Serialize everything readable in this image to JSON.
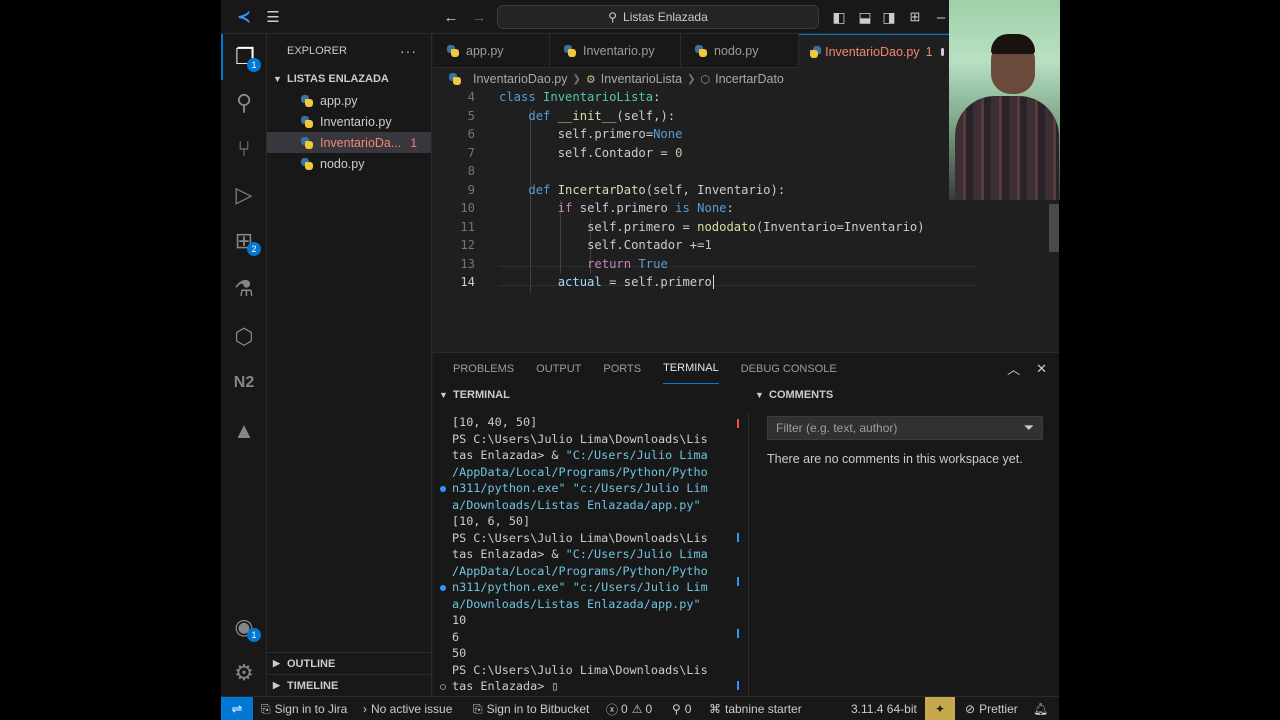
{
  "title_bar": {
    "search_text": "Listas Enlazada"
  },
  "explorer": {
    "title": "EXPLORER",
    "more": "···",
    "folder": "LISTAS ENLAZADA",
    "files": [
      {
        "name": "app.py"
      },
      {
        "name": "Inventario.py"
      },
      {
        "name": "InventarioDa...",
        "problems": "1"
      },
      {
        "name": "nodo.py"
      }
    ],
    "outline": "OUTLINE",
    "timeline": "TIMELINE"
  },
  "activity_badges": {
    "explorer": "1",
    "extensions": "2",
    "accounts": "1"
  },
  "tabs": [
    {
      "label": "app.py"
    },
    {
      "label": "Inventario.py"
    },
    {
      "label": "nodo.py"
    },
    {
      "label": "InventarioDao.py",
      "count": "1"
    }
  ],
  "breadcrumb": {
    "file": "InventarioDao.py",
    "class": "InventarioLista",
    "method": "IncertarDato"
  },
  "code_lines": [
    {
      "n": "4"
    },
    {
      "n": "5"
    },
    {
      "n": "6"
    },
    {
      "n": "7"
    },
    {
      "n": "8"
    },
    {
      "n": "9"
    },
    {
      "n": "10"
    },
    {
      "n": "11"
    },
    {
      "n": "12"
    },
    {
      "n": "13"
    },
    {
      "n": "14"
    }
  ],
  "code": {
    "l4_kw": "class",
    "l4_name": "InventarioLista",
    "l4_end": ":",
    "l5_kw": "def",
    "l5_fn": "__init__",
    "l5_rest": "(self,):",
    "l6_a": "self.primero=",
    "l6_b": "None",
    "l7_a": "self.Contador = ",
    "l7_b": "0",
    "l9_kw": "def",
    "l9_fn": "IncertarDato",
    "l9_rest": "(self, Inventario):",
    "l10_kw": "if",
    "l10_a": " self.primero ",
    "l10_is": "is",
    "l10_none": " None",
    "l10_end": ":",
    "l11_a": "self.primero = ",
    "l11_fn": "nododato",
    "l11_rest": "(Inventario=Inventario)",
    "l12_a": "self.Contador +=",
    "l12_b": "1",
    "l13_kw": "return",
    "l13_b": " True",
    "l14_a": "actual",
    "l14_b": " = self.primero"
  },
  "panel_tabs": [
    "PROBLEMS",
    "OUTPUT",
    "PORTS",
    "TERMINAL",
    "DEBUG CONSOLE"
  ],
  "terminal": {
    "header": "TERMINAL",
    "lines": [
      {
        "t": "[10, 40, 50]"
      },
      {
        "t": "PS C:\\Users\\Julio Lima\\Downloads\\Lis"
      },
      {
        "t": "tas Enlazada> & ",
        "s": "\"C:/Users/Julio Lima"
      },
      {
        "s": "/AppData/Local/Programs/Python/Pytho"
      },
      {
        "s": "n311/python.exe\"",
        "t2": " \"c:/Users/Julio Lim"
      },
      {
        "t2": "a/Downloads/Listas Enlazada/app.py\""
      },
      {
        "t": "[10, 6, 50]"
      },
      {
        "t": "PS C:\\Users\\Julio Lima\\Downloads\\Lis"
      },
      {
        "t": "tas Enlazada> & ",
        "s": "\"C:/Users/Julio Lima"
      },
      {
        "s": "/AppData/Local/Programs/Python/Pytho"
      },
      {
        "s": "n311/python.exe\"",
        "t2": " \"c:/Users/Julio Lim"
      },
      {
        "t2": "a/Downloads/Listas Enlazada/app.py\""
      },
      {
        "t": "10"
      },
      {
        "t": "6"
      },
      {
        "t": "50"
      },
      {
        "t": "PS C:\\Users\\Julio Lima\\Downloads\\Lis"
      },
      {
        "t": "tas Enlazada> ",
        "c": "▯"
      }
    ]
  },
  "comments": {
    "header": "COMMENTS",
    "filter_placeholder": "Filter (e.g. text, author)",
    "empty": "There are no comments in this workspace yet."
  },
  "status_bar": {
    "jira": "Sign in to Jira",
    "issue": "No active issue",
    "bitbucket": "Sign in to Bitbucket",
    "errors": "0",
    "warnings": "0",
    "ports": "0",
    "tabnine": "tabnine starter",
    "python": "3.11.4 64-bit",
    "prettier": "Prettier"
  }
}
